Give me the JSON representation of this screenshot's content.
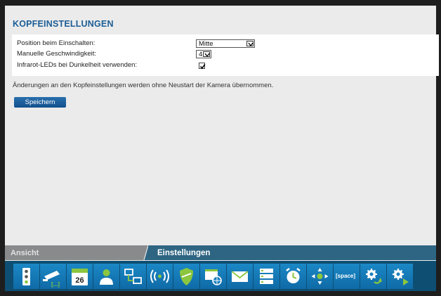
{
  "settings": {
    "title": "KOPFEINSTELLUNGEN",
    "rows": [
      {
        "label": "Position beim Einschalten:",
        "value": "Mitte"
      },
      {
        "label": "Manuelle Geschwindigkeit:",
        "value": "4"
      },
      {
        "label": "Infrarot-LEDs bei Dunkelheit verwenden:",
        "checked": true
      }
    ],
    "note": "Änderungen an den Kopfeinstellungen werden ohne Neustart der Kamera übernommen.",
    "save_label": "Speichern"
  },
  "tabs": [
    {
      "label": "Ansicht",
      "active": false
    },
    {
      "label": "Einstellungen",
      "active": true
    }
  ],
  "toolbar": {
    "icons": [
      "traffic-light-icon",
      "camera-network-icon",
      "calendar-icon",
      "user-icon",
      "network-icon",
      "wireless-icon",
      "shield-icon",
      "browser-globe-icon",
      "mail-icon",
      "storage-icon",
      "alarm-clock-icon",
      "pan-tilt-icon",
      "space-icon",
      "settings-refresh-icon",
      "settings-next-icon"
    ],
    "calendar_day": "26",
    "space_label": "[space]",
    "accent_color": "#1a80bf",
    "shield_color": "#8bc63f"
  }
}
